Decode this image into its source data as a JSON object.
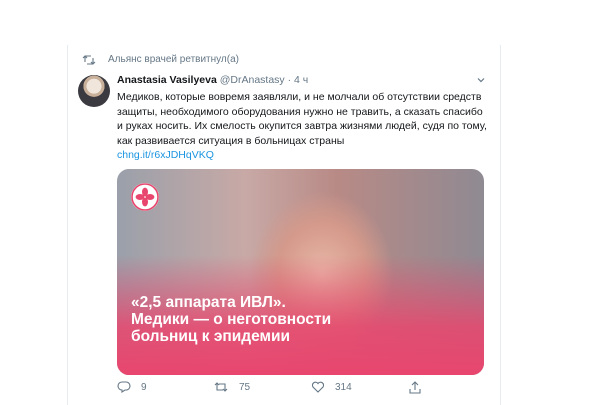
{
  "retweet": {
    "label": "Альянс врачей ретвитнул(а)",
    "icon": "retweet-icon"
  },
  "tweet": {
    "author_name": "Anastasia Vasilyeva",
    "handle": "@DrAnastasy",
    "separator": "·",
    "time": "4 ч",
    "text": "Медиков, которые вовремя заявляли, и не молчали об отсутствии средств защиты, необходимого оборудования нужно не травить, а сказать спасибо и руках носить. Их смелость окупится завтра жизнями людей, судя по тому, как развивается ситуация в больницах страны",
    "link": "chng.it/r6xJDHqVKQ"
  },
  "media": {
    "headline_lines": [
      "«2,5 аппарата ИВЛ».",
      "Медики — о неготовности",
      "больниц к эпидемии"
    ],
    "logo": "medical-union-logo",
    "accent": "#e8466e"
  },
  "actions": {
    "replies": "9",
    "retweets": "75",
    "likes": "314"
  },
  "colors": {
    "text": "#14171a",
    "secondary": "#657786",
    "link": "#1b95e0"
  }
}
